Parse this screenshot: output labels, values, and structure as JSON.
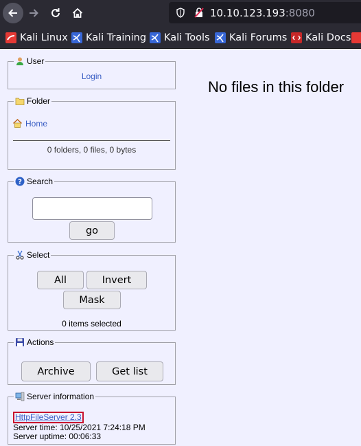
{
  "browser": {
    "url_host": "10.10.123.193",
    "url_port": ":8080",
    "bookmarks": [
      "Kali Linux",
      "Kali Training",
      "Kali Tools",
      "Kali Forums",
      "Kali Docs"
    ]
  },
  "user": {
    "legend": "User",
    "login_label": "Login"
  },
  "folder": {
    "legend": "Folder",
    "home_label": "Home",
    "stats": "0 folders, 0 files, 0 bytes"
  },
  "search": {
    "legend": "Search",
    "value": "",
    "go_label": "go"
  },
  "select": {
    "legend": "Select",
    "all_label": "All",
    "invert_label": "Invert",
    "mask_label": "Mask",
    "status": "0 items selected"
  },
  "actions": {
    "legend": "Actions",
    "archive_label": "Archive",
    "getlist_label": "Get list"
  },
  "server": {
    "legend": "Server information",
    "version_link": "HttpFileServer 2.3",
    "time": "Server time: 10/25/2021 7:24:18 PM",
    "uptime": "Server uptime: 00:06:33"
  },
  "main": {
    "message": "No files in this folder"
  }
}
